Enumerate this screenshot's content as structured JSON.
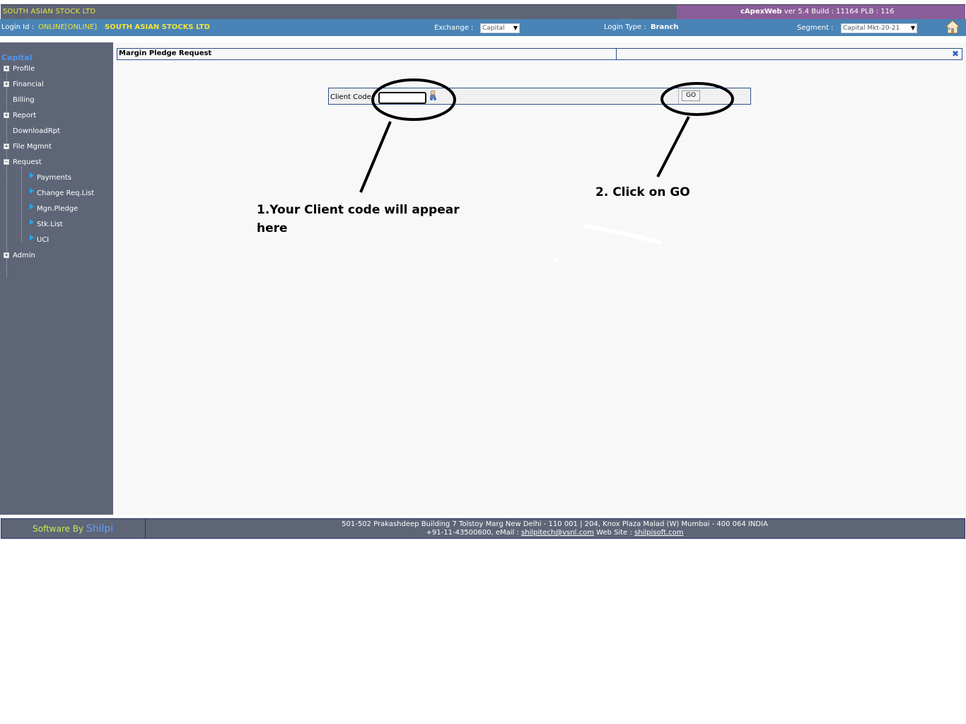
{
  "header": {
    "company": "SOUTH ASIAN STOCK LTD",
    "app_name": "cApexWeb",
    "version": "ver 5.4 Build : 11164  PLB : 116"
  },
  "loginbar": {
    "login_label": "Login Id :",
    "login_id": "ONLINE[ONLINE]",
    "login_company": "SOUTH ASIAN STOCKS LTD",
    "exchange_label": "Exchange :",
    "exchange_value": "Capital",
    "login_type_label": "Login Type :",
    "login_type_value": "Branch",
    "segment_label": "Segment :",
    "segment_value": "Capital Mkt-20-21"
  },
  "sidebar": {
    "title": "Capital",
    "items": [
      {
        "label": "Profile",
        "expander": "+"
      },
      {
        "label": "Financial",
        "expander": "+"
      },
      {
        "label": "Billing",
        "expander": ""
      },
      {
        "label": "Report",
        "expander": "+"
      },
      {
        "label": "DownloadRpt",
        "expander": ""
      },
      {
        "label": "File Mgmnt",
        "expander": "+"
      },
      {
        "label": "Request",
        "expander": "−"
      },
      {
        "label": "Admin",
        "expander": "+"
      }
    ],
    "request_children": [
      "Payments",
      "Change Req.List",
      "Mgn.Pledge",
      "Stk.List",
      "UCI"
    ]
  },
  "main": {
    "title": "Margin Pledge Request",
    "client_code_label": "Client Code",
    "client_code_value": "",
    "go_label": "GO"
  },
  "annotations": {
    "step1_line1": "1.Your Client code will appear",
    "step1_line2": "here",
    "step2": "2. Click on GO"
  },
  "footer": {
    "software_by": "Software By",
    "brand": "Shilpi",
    "address": "501-502 Prakashdeep Building 7 Tolstoy Marg New Delhi - 110 001  |   204, Knox Plaza Malad (W) Mumbai - 400 064 INDIA",
    "phone_email_prefix": "+91-11-43500600, eMail :",
    "email": "shilpitech@vsnl.com",
    "website_prefix": "Web Site :",
    "website": "shilpisoft.com"
  },
  "colors": {
    "sidebar_bg": "#5e6577",
    "loginbar_bg": "#4a84b6",
    "version_bg": "#8a5e98",
    "accent_yellow": "#f2e43a"
  }
}
